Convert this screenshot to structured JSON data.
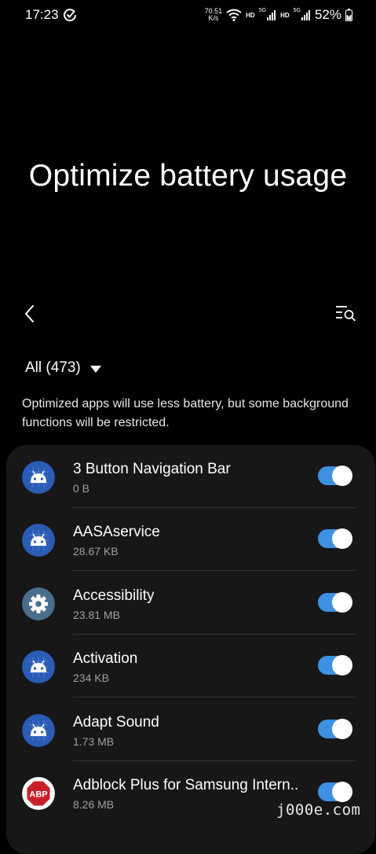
{
  "status_bar": {
    "time": "17:23",
    "net_speed_value": "70.51",
    "net_speed_unit": "K/s",
    "hd_label_1": "HD",
    "sig_label_1": "5G",
    "hd_label_2": "HD",
    "sig_label_2": "5G",
    "battery_percent": "52%"
  },
  "header": {
    "title": "Optimize battery usage"
  },
  "filter": {
    "label": "All (473)"
  },
  "description": "Optimized apps will use less battery, but some background functions will be restricted.",
  "apps": [
    {
      "name": "3 Button Navigation Bar",
      "size": "0 B",
      "icon": "android-icon",
      "optimized": true
    },
    {
      "name": "AASAservice",
      "size": "28.67 KB",
      "icon": "android-icon",
      "optimized": true
    },
    {
      "name": "Accessibility",
      "size": "23.81 MB",
      "icon": "gear-icon",
      "optimized": true
    },
    {
      "name": "Activation",
      "size": "234 KB",
      "icon": "android-icon",
      "optimized": true
    },
    {
      "name": "Adapt Sound",
      "size": "1.73 MB",
      "icon": "android-icon",
      "optimized": true
    },
    {
      "name": "Adblock Plus for Samsung Intern..",
      "size": "8.26 MB",
      "icon": "abp-icon",
      "optimized": true
    }
  ],
  "abp_logo_text": "ABP",
  "watermark": "j000e.com",
  "colors": {
    "background": "#000000",
    "card": "#171717",
    "toggle_on": "#3e91e2",
    "android_icon_bg": "#2a5bb5",
    "gear_icon_bg": "#4a6d8c",
    "abp_red": "#c8202a"
  }
}
